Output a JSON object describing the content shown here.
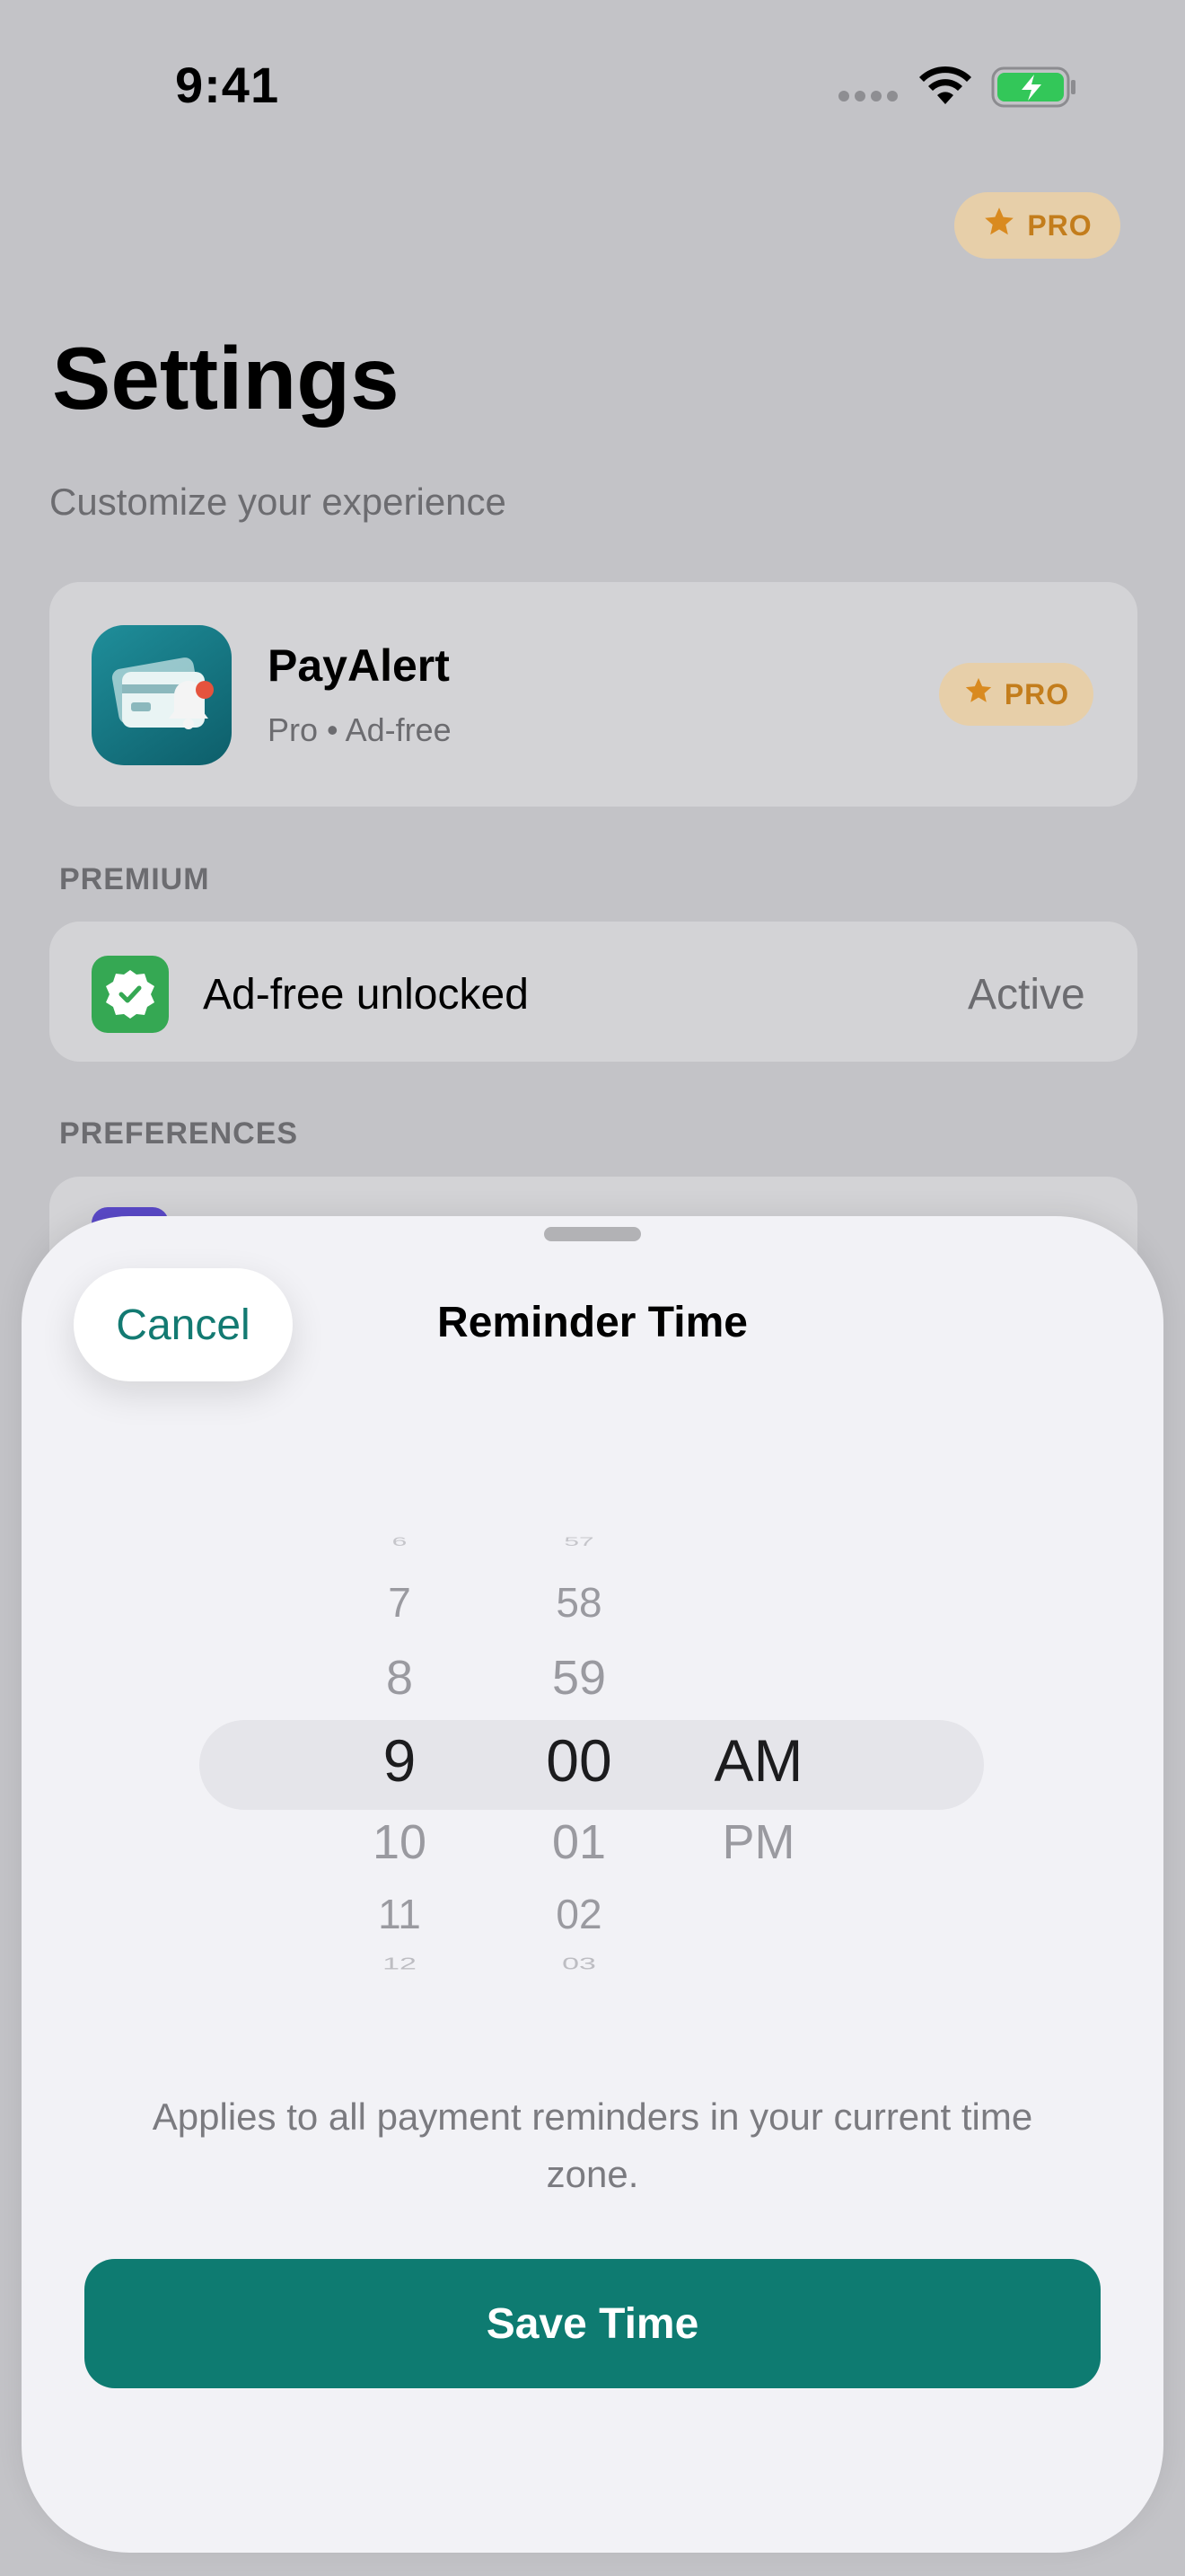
{
  "status_bar": {
    "time": "9:41"
  },
  "header": {
    "pro_badge": "PRO",
    "title": "Settings",
    "subtitle": "Customize your experience"
  },
  "app_card": {
    "name": "PayAlert",
    "subtitle": "Pro • Ad-free",
    "badge": "PRO"
  },
  "premium": {
    "header": "PREMIUM",
    "row_label": "Ad-free unlocked",
    "row_value": "Active"
  },
  "preferences": {
    "header": "PREFERENCES"
  },
  "sheet": {
    "cancel_label": "Cancel",
    "title": "Reminder Time",
    "picker": {
      "hours": [
        "6",
        "7",
        "8",
        "9",
        "10",
        "11",
        "12"
      ],
      "minutes": [
        "57",
        "58",
        "59",
        "00",
        "01",
        "02",
        "03"
      ],
      "periods": [
        "AM",
        "PM"
      ],
      "selected_hour": "9",
      "selected_minute": "00",
      "selected_period": "AM"
    },
    "note": "Applies to all payment reminders in your current time zone.",
    "save_label": "Save Time"
  },
  "colors": {
    "accent": "#0e7b71",
    "pro": "#c37d1c",
    "active_icon": "#35a853"
  },
  "icons": [
    "star-icon",
    "wifi-icon",
    "battery-icon",
    "app-icon",
    "checkmark-badge-icon"
  ]
}
